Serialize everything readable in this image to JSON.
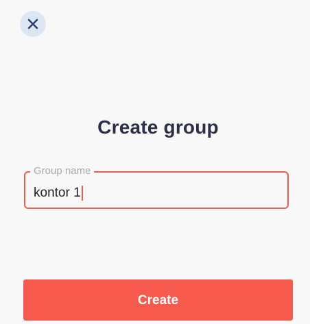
{
  "header": {
    "close_icon": "close-icon"
  },
  "title": "Create group",
  "form": {
    "group_name": {
      "label": "Group name",
      "value": "kontor 1"
    }
  },
  "actions": {
    "create_label": "Create"
  },
  "colors": {
    "accent": "#f65a4c",
    "field_border": "#ec5f4f",
    "title": "#2c2f45",
    "close_bg": "#dde7f4",
    "close_icon": "#2c3e73",
    "background": "#f8f8f8"
  }
}
